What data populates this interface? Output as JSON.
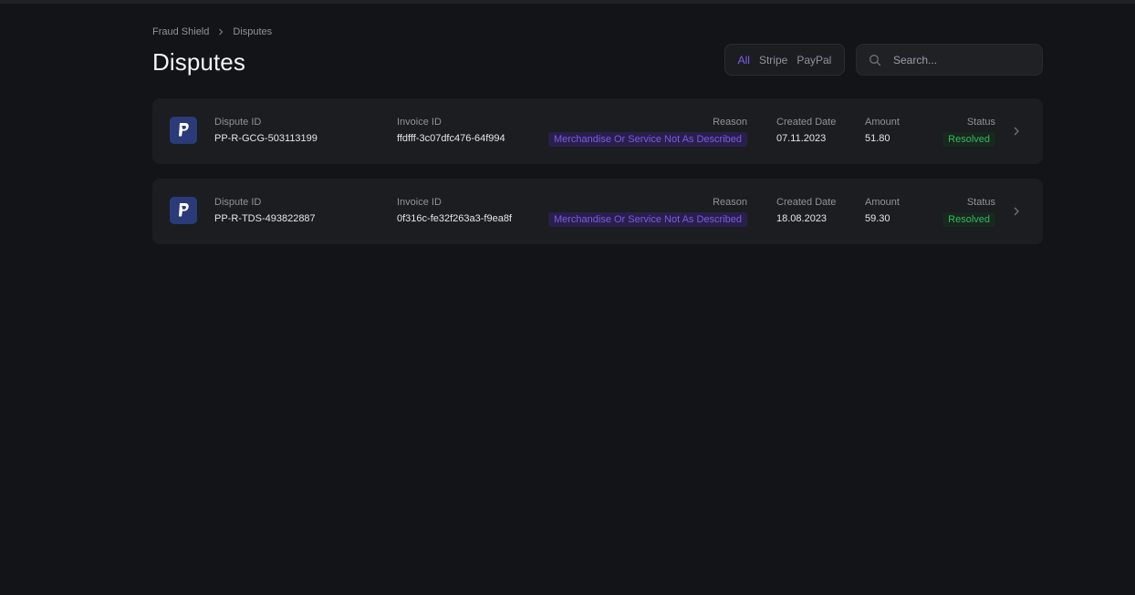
{
  "breadcrumb": {
    "root": "Fraud Shield",
    "current": "Disputes"
  },
  "page": {
    "title": "Disputes"
  },
  "filters": {
    "all": "All",
    "stripe": "Stripe",
    "paypal": "PayPal",
    "active": "All"
  },
  "search": {
    "placeholder": "Search..."
  },
  "labels": {
    "dispute_id": "Dispute ID",
    "invoice_id": "Invoice ID",
    "reason": "Reason",
    "created_date": "Created Date",
    "amount": "Amount",
    "status": "Status"
  },
  "disputes": [
    {
      "provider_icon": "paypal-icon",
      "dispute_id": "PP-R-GCG-503113199",
      "invoice_id": "ffdfff-3c07dfc476-64f994",
      "reason": "Merchandise Or Service Not As Described",
      "created_date": "07.11.2023",
      "amount": "51.80",
      "status": "Resolved"
    },
    {
      "provider_icon": "paypal-icon",
      "dispute_id": "PP-R-TDS-493822887",
      "invoice_id": "0f316c-fe32f263a3-f9ea8f",
      "reason": "Merchandise Or Service Not As Described",
      "created_date": "18.08.2023",
      "amount": "59.30",
      "status": "Resolved"
    }
  ],
  "colors": {
    "accent": "#7c5cf2",
    "reason_badge_bg": "#2a1f4a",
    "status_resolved": "#35b85d",
    "paypal_bg": "#2b3a78"
  }
}
